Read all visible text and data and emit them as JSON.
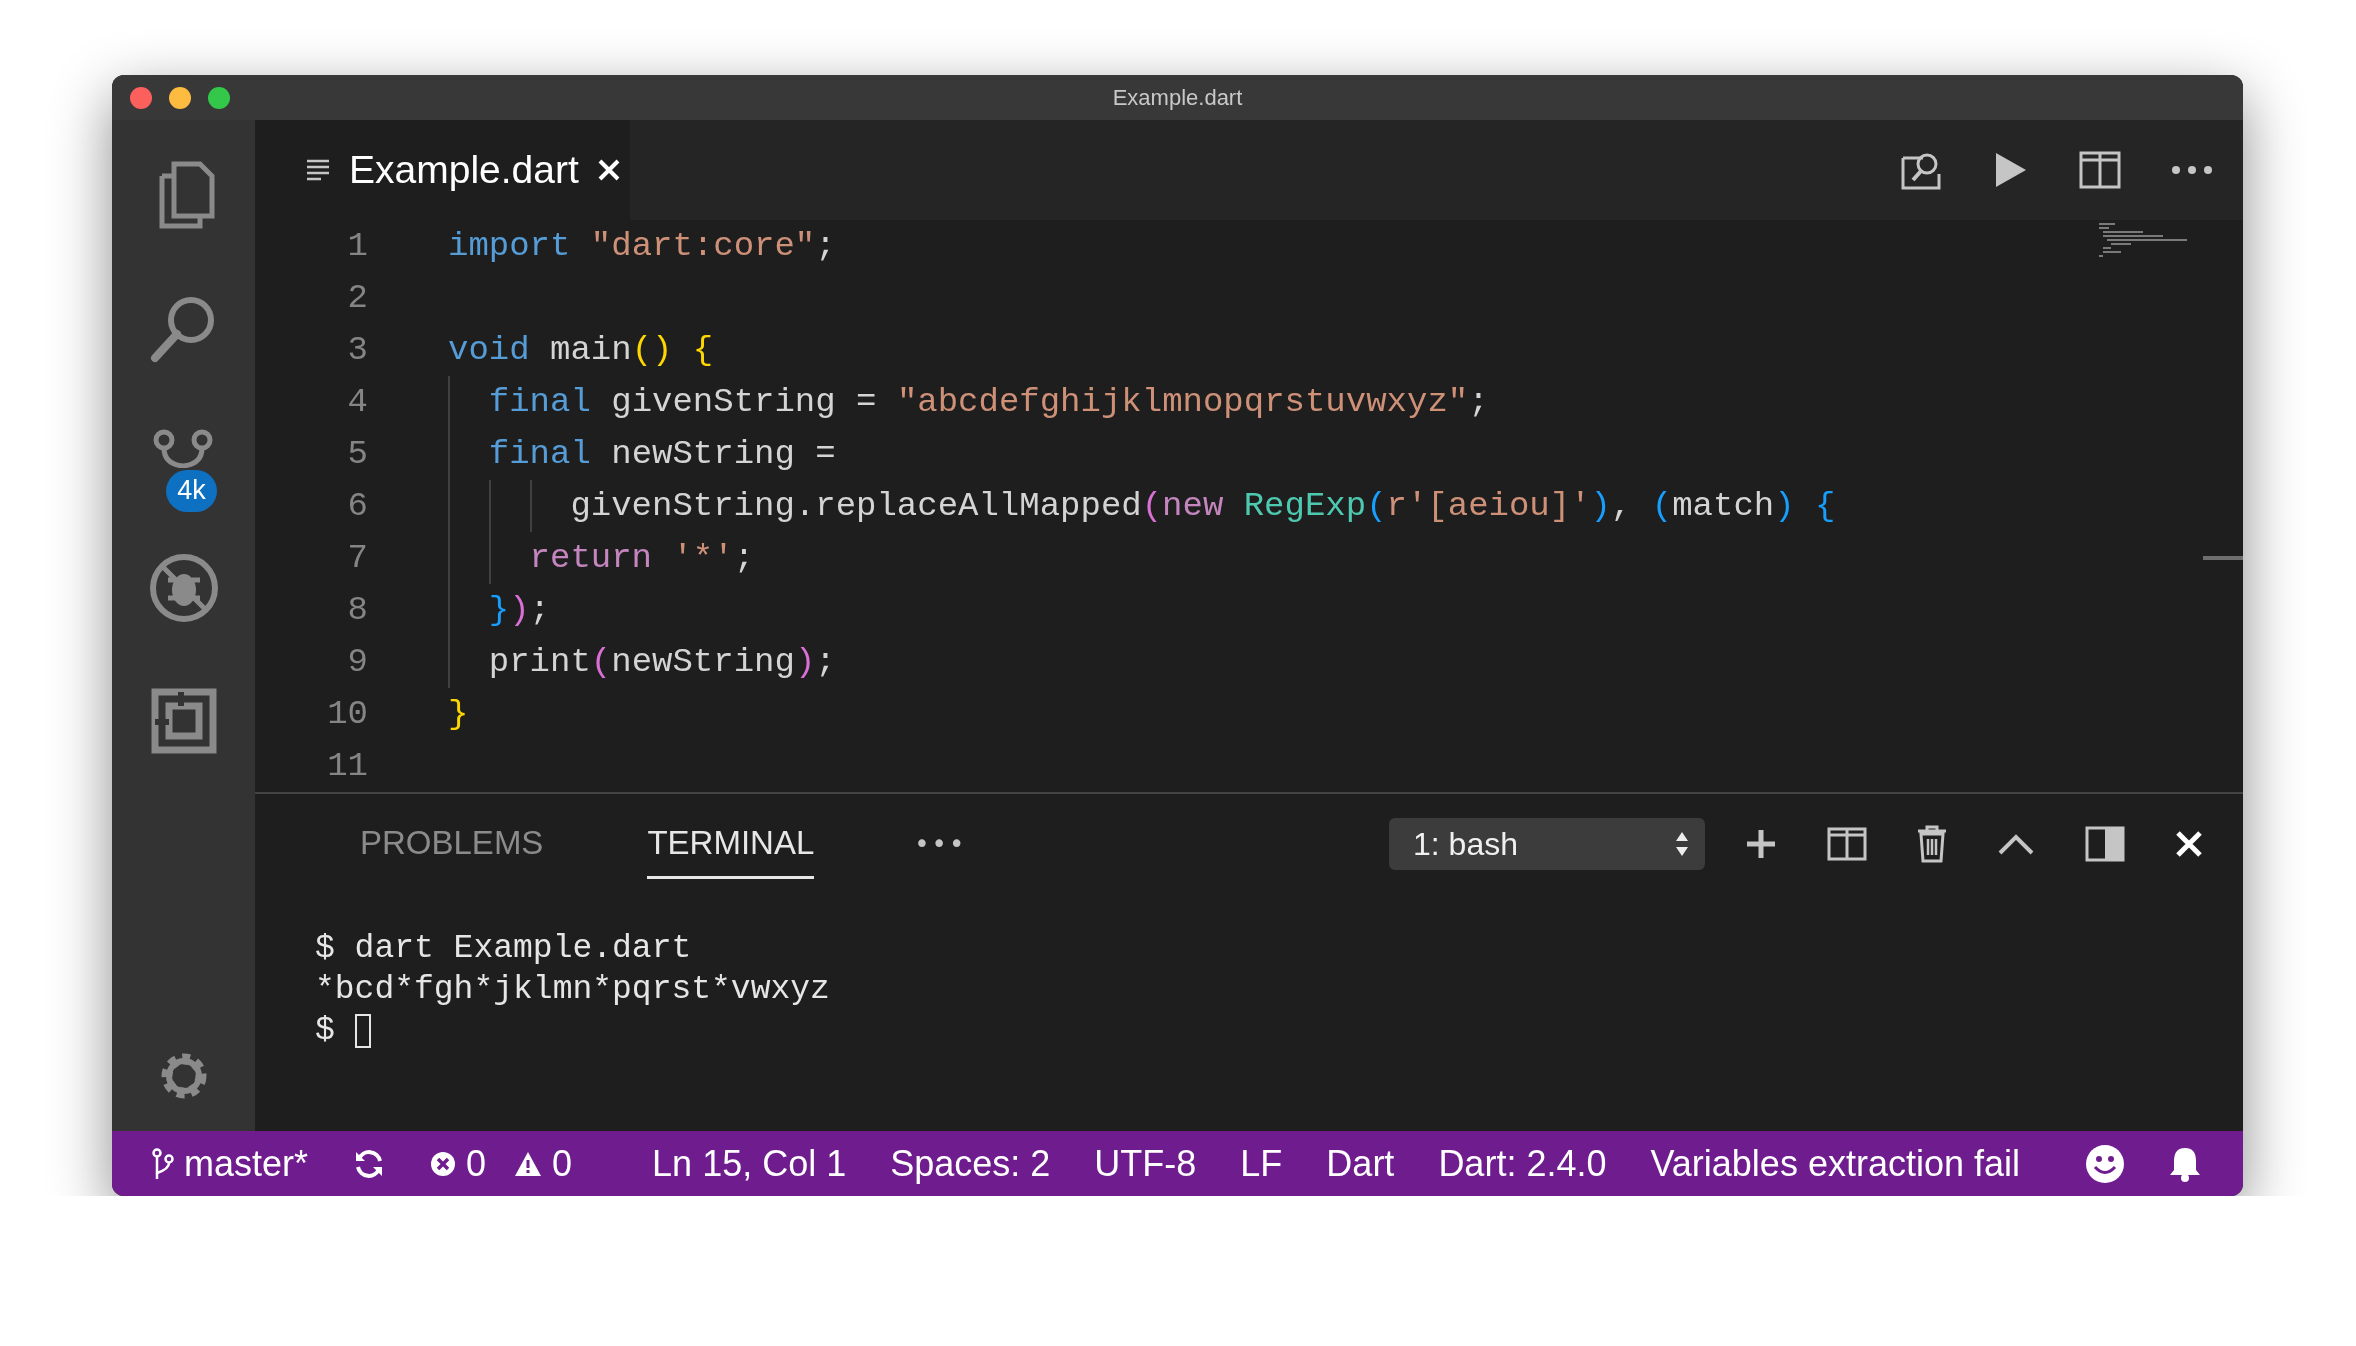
{
  "window": {
    "title": "Example.dart"
  },
  "activity_bar": {
    "source_control_badge": "4k"
  },
  "tab": {
    "label": "Example.dart"
  },
  "editor": {
    "lines": [
      {
        "number": "1",
        "tokens": [
          {
            "kind": "keyword",
            "text": "import"
          },
          {
            "kind": "string",
            "text": " \"dart:core\""
          },
          {
            "kind": "plain",
            "text": ";"
          }
        ]
      },
      {
        "number": "2"
      },
      {
        "number": "3",
        "tokens": [
          {
            "kind": "keyword",
            "text": "void"
          },
          {
            "kind": "plain",
            "text": " main"
          },
          {
            "kind": "bracket1",
            "text": "()"
          },
          {
            "kind": "bracket1",
            "text": " {"
          }
        ]
      },
      {
        "number": "4",
        "tokens": [
          {
            "kind": "keyword",
            "text": "  final"
          },
          {
            "kind": "plain",
            "text": " givenString = "
          },
          {
            "kind": "string",
            "text": "\"abcdefghijklmnopqrstuvwxyz\""
          },
          {
            "kind": "plain",
            "text": ";"
          }
        ]
      },
      {
        "number": "5",
        "tokens": [
          {
            "kind": "keyword",
            "text": "  final"
          },
          {
            "kind": "plain",
            "text": " newString ="
          }
        ]
      },
      {
        "number": "6",
        "tokens": [
          {
            "kind": "plain",
            "text": "      givenString.replaceAllMapped"
          },
          {
            "kind": "bracket2",
            "text": "("
          },
          {
            "kind": "control",
            "text": "new"
          },
          {
            "kind": "type",
            "text": " RegExp"
          },
          {
            "kind": "bracket3",
            "text": "("
          },
          {
            "kind": "string",
            "text": "r'[aeiou]'"
          },
          {
            "kind": "bracket3",
            "text": ")"
          },
          {
            "kind": "plain",
            "text": ", "
          },
          {
            "kind": "bracket3",
            "text": "("
          },
          {
            "kind": "plain",
            "text": "match"
          },
          {
            "kind": "bracket3",
            "text": ")"
          },
          {
            "kind": "bracket3",
            "text": " {"
          }
        ]
      },
      {
        "number": "7",
        "tokens": [
          {
            "kind": "control",
            "text": "    return"
          },
          {
            "kind": "string",
            "text": " '*'"
          },
          {
            "kind": "plain",
            "text": ";"
          }
        ]
      },
      {
        "number": "8",
        "tokens": [
          {
            "kind": "bracket3",
            "text": "  }"
          },
          {
            "kind": "bracket2",
            "text": ")"
          },
          {
            "kind": "plain",
            "text": ";"
          }
        ]
      },
      {
        "number": "9",
        "tokens": [
          {
            "kind": "plain",
            "text": "  print"
          },
          {
            "kind": "bracket2",
            "text": "("
          },
          {
            "kind": "plain",
            "text": "newString"
          },
          {
            "kind": "bracket2",
            "text": ")"
          },
          {
            "kind": "plain",
            "text": ";"
          }
        ]
      },
      {
        "number": "10",
        "tokens": [
          {
            "kind": "bracket1",
            "text": "}"
          }
        ]
      },
      {
        "number": "11"
      }
    ]
  },
  "panel": {
    "tabs": [
      {
        "label": "PROBLEMS",
        "selected": false
      },
      {
        "label": "TERMINAL",
        "selected": true
      }
    ],
    "more": "•••",
    "terminal_select": "1: bash",
    "terminal_lines": [
      "$ dart Example.dart",
      "*bcd*fgh*jklmn*pqrst*vwxyz",
      "$ "
    ]
  },
  "status_bar": {
    "branch": "master*",
    "errors": "0",
    "warnings": "0",
    "items": [
      "Ln 15, Col 1",
      "Spaces: 2",
      "UTF-8",
      "LF",
      "Dart",
      "Dart: 2.4.0",
      "Variables extraction fail"
    ]
  }
}
